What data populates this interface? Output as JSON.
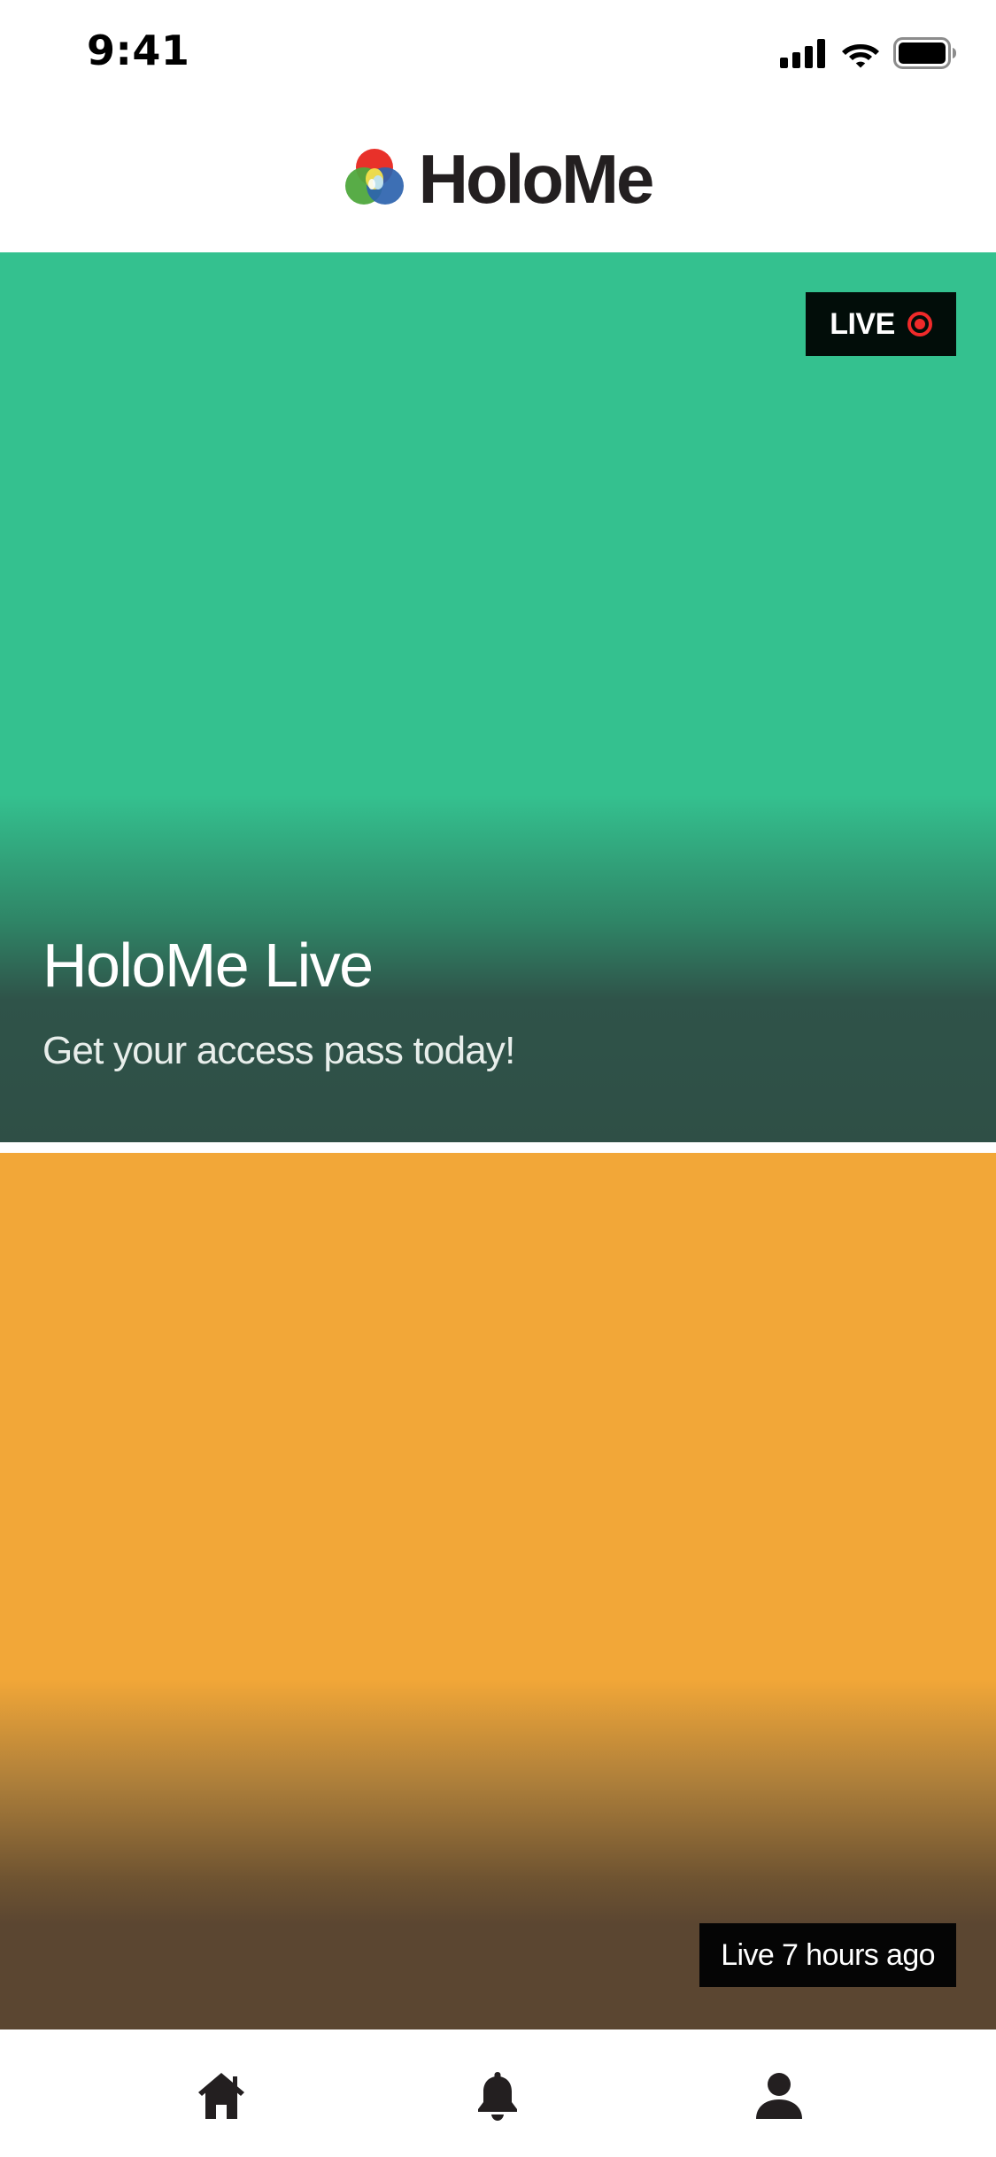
{
  "status_bar": {
    "time": "9:41",
    "icons": [
      "cellular-signal-icon",
      "wifi-icon",
      "battery-icon"
    ]
  },
  "header": {
    "brand_name": "HoloMe",
    "logo_icon": "holome-logo-icon"
  },
  "feed": {
    "cards": [
      {
        "badge_label": "LIVE",
        "badge_icon": "record-dot-icon",
        "title": "HoloMe Live",
        "subtitle": "Get your access pass today!",
        "background_color": "#34c18f"
      },
      {
        "badge_label": "Live 7 hours ago",
        "background_color": "#f2a738"
      }
    ]
  },
  "tab_bar": {
    "items": [
      {
        "icon": "home-icon"
      },
      {
        "icon": "bell-icon"
      },
      {
        "icon": "person-icon"
      }
    ]
  },
  "colors": {
    "live_red": "#f02a2a",
    "brand_text": "#231f20"
  }
}
